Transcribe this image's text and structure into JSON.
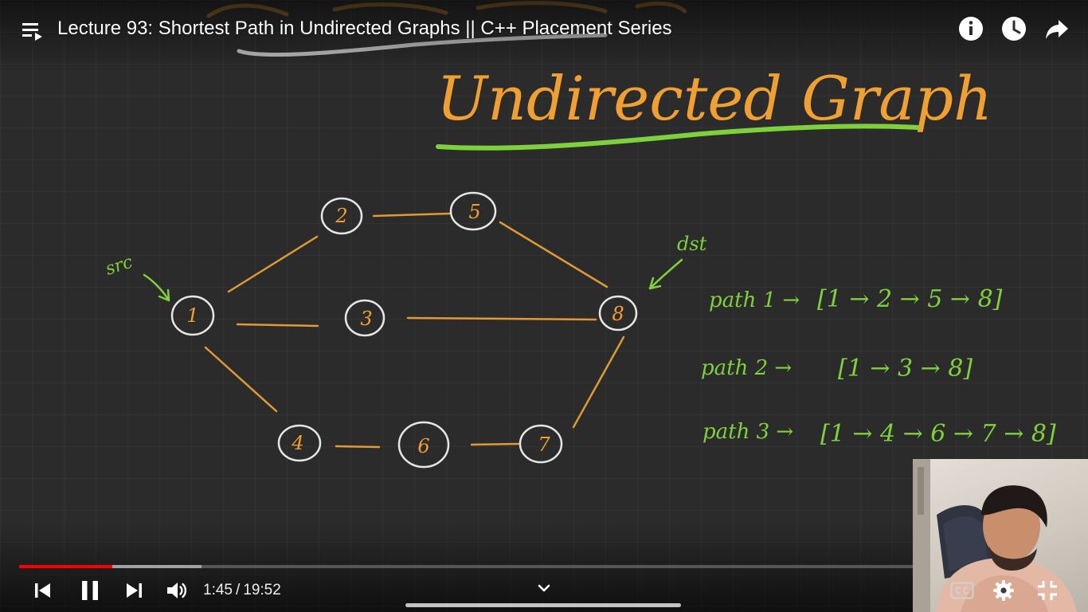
{
  "player": {
    "title": "Lecture 93: Shortest Path in Undirected Graphs || C++ Placement Series",
    "time_current": "1:45",
    "time_separator": "/",
    "time_total": "19:52",
    "progress_played": 0.089,
    "progress_buffered": 0.174,
    "accent_color": "#ff0000"
  },
  "board": {
    "heading": "Undirected Graph",
    "src_label": "src",
    "dst_label": "dst",
    "nodes": [
      "1",
      "2",
      "3",
      "4",
      "5",
      "6",
      "7",
      "8"
    ],
    "paths": [
      {
        "label": "path 1 →",
        "route": "[1 → 2 → 5 → 8]"
      },
      {
        "label": "path 2 →",
        "route": "[1 → 3 → 8]"
      },
      {
        "label": "path 3 →",
        "route": "[1 → 4 → 6 → 7 → 8]"
      }
    ],
    "ink_orange": "#f0a033",
    "ink_green": "#7fd13b"
  },
  "icons": {
    "playlist": "playlist-icon",
    "info": "info-icon",
    "watch_later": "clock-icon",
    "share": "share-icon",
    "previous": "skip-previous-icon",
    "pause": "pause-icon",
    "next": "skip-next-icon",
    "volume": "volume-icon",
    "chevron": "chevron-down-icon",
    "captions": "cc-icon",
    "settings": "gear-icon",
    "exit_fullscreen": "exit-fullscreen-icon"
  }
}
